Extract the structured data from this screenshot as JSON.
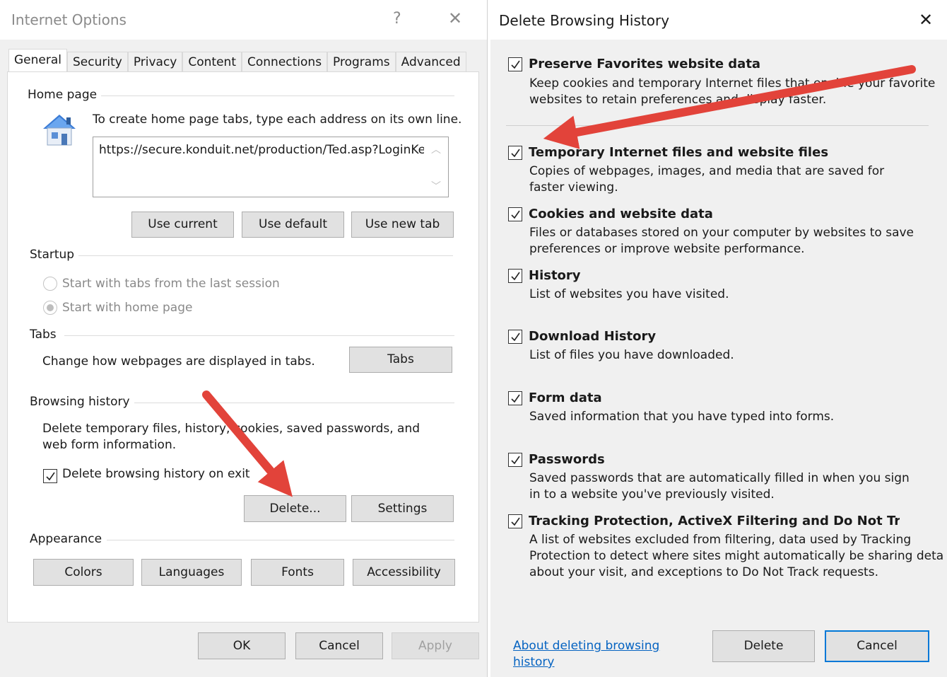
{
  "internet_options": {
    "title": "Internet Options",
    "help_glyph": "?",
    "close_glyph": "✕",
    "tabs": [
      {
        "label": "General",
        "active": true
      },
      {
        "label": "Security",
        "active": false
      },
      {
        "label": "Privacy",
        "active": false
      },
      {
        "label": "Content",
        "active": false
      },
      {
        "label": "Connections",
        "active": false
      },
      {
        "label": "Programs",
        "active": false
      },
      {
        "label": "Advanced",
        "active": false
      }
    ],
    "home_page": {
      "group_label": "Home page",
      "instruction": "To create home page tabs, type each address on its own line.",
      "url_value": "https://secure.konduit.net/production/Ted.asp?LoginKe",
      "icon": "house-icon",
      "buttons": {
        "use_current": "Use current",
        "use_default": "Use default",
        "use_new_tab": "Use new tab"
      }
    },
    "startup": {
      "group_label": "Startup",
      "options": [
        {
          "label": "Start with tabs from the last session",
          "selected": false
        },
        {
          "label": "Start with home page",
          "selected": true
        }
      ]
    },
    "tabs_group": {
      "group_label": "Tabs",
      "description": "Change how webpages are displayed in tabs.",
      "button": "Tabs"
    },
    "browsing_history": {
      "group_label": "Browsing history",
      "description_line1": "Delete temporary files, history, cookies, saved passwords, and",
      "description_line2": "web form information.",
      "delete_on_exit_label": "Delete browsing history on exit",
      "delete_on_exit_checked": true,
      "delete_button": "Delete...",
      "settings_button": "Settings"
    },
    "appearance": {
      "group_label": "Appearance",
      "buttons": {
        "colors": "Colors",
        "languages": "Languages",
        "fonts": "Fonts",
        "accessibility": "Accessibility"
      }
    },
    "footer": {
      "ok": "OK",
      "cancel": "Cancel",
      "apply": "Apply"
    }
  },
  "delete_browsing_history": {
    "title": "Delete Browsing History",
    "close_glyph": "✕",
    "options": [
      {
        "title": "Preserve Favorites website data",
        "checked": true,
        "desc": [
          "Keep cookies and temporary Internet files that enable your favorite",
          "websites to retain preferences and display faster."
        ]
      },
      {
        "title": "Temporary Internet files and website files",
        "checked": true,
        "desc": [
          "Copies of webpages, images, and media that are saved for",
          "faster viewing."
        ]
      },
      {
        "title": "Cookies and website data",
        "checked": true,
        "desc": [
          "Files or databases stored on your computer by websites to save",
          "preferences or improve website performance."
        ]
      },
      {
        "title": "History",
        "checked": true,
        "desc": [
          "List of websites you have visited."
        ]
      },
      {
        "title": "Download History",
        "checked": true,
        "desc": [
          "List of files you have downloaded."
        ]
      },
      {
        "title": "Form data",
        "checked": true,
        "desc": [
          "Saved information that you have typed into forms."
        ]
      },
      {
        "title": "Passwords",
        "checked": true,
        "desc": [
          "Saved passwords that are automatically filled in when you sign",
          "in to a website you've previously visited."
        ]
      },
      {
        "title": "Tracking Protection, ActiveX Filtering and Do Not Track c",
        "checked": true,
        "desc": [
          "A list of websites excluded from filtering, data used by Tracking",
          "Protection to detect where sites might automatically be sharing details",
          "about your visit, and exceptions to Do Not Track requests."
        ]
      }
    ],
    "about_link_line1": "About deleting browsing",
    "about_link_line2": "history",
    "delete_button": "Delete",
    "cancel_button": "Cancel"
  },
  "annotations": {
    "arrow_color": "#e2433a"
  }
}
